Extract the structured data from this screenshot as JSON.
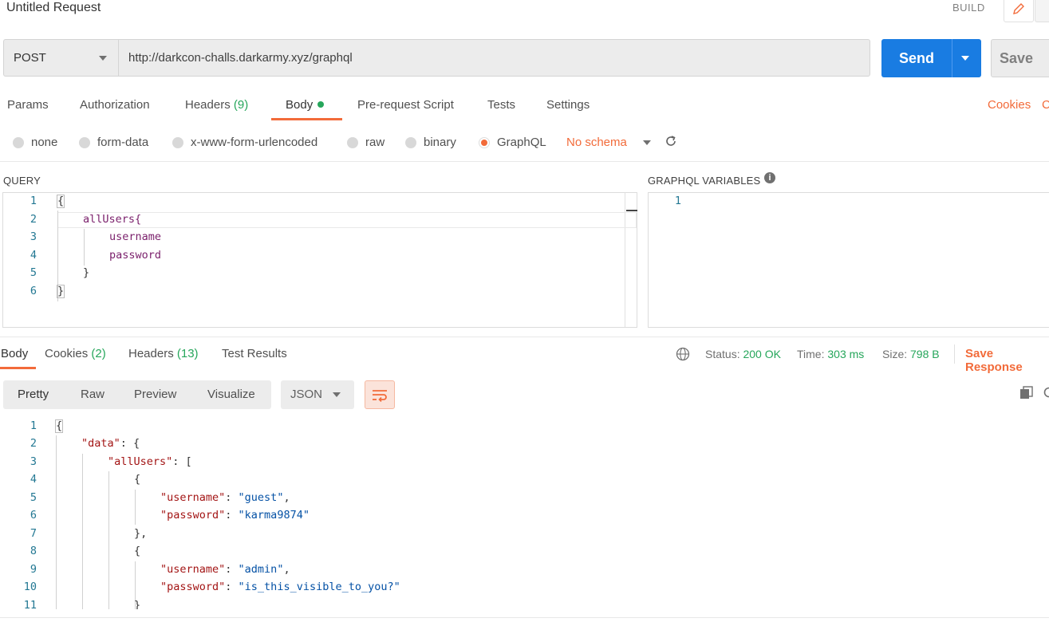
{
  "header": {
    "title": "Untitled Request",
    "build_label": "BUILD"
  },
  "request": {
    "method": "POST",
    "url": "http://darkcon-challs.darkarmy.xyz/graphql",
    "send_label": "Send",
    "save_label": "Save"
  },
  "tabs": {
    "params": "Params",
    "authorization": "Authorization",
    "headers": "Headers",
    "headers_count": "(9)",
    "body": "Body",
    "prerequest": "Pre-request Script",
    "tests": "Tests",
    "settings": "Settings",
    "cookies": "Cookies",
    "code": "C"
  },
  "body_types": {
    "none": "none",
    "form_data": "form-data",
    "urlencoded": "x-www-form-urlencoded",
    "raw": "raw",
    "binary": "binary",
    "graphql": "GraphQL",
    "schema": "No schema"
  },
  "query": {
    "label": "QUERY",
    "lines": [
      {
        "n": "1",
        "text": "{"
      },
      {
        "n": "2",
        "text": "allUsers{"
      },
      {
        "n": "3",
        "text": "username"
      },
      {
        "n": "4",
        "text": "password"
      },
      {
        "n": "5",
        "text": "}"
      },
      {
        "n": "6",
        "text": "}"
      }
    ]
  },
  "variables": {
    "label": "GRAPHQL VARIABLES",
    "line1": "1"
  },
  "response": {
    "tabs": {
      "body": "Body",
      "cookies": "Cookies",
      "cookies_count": "(2)",
      "headers": "Headers",
      "headers_count": "(13)",
      "tests": "Test Results"
    },
    "status_label": "Status:",
    "status_value": "200 OK",
    "time_label": "Time:",
    "time_value": "303 ms",
    "size_label": "Size:",
    "size_value": "798 B",
    "save_response": "Save Response",
    "views": {
      "pretty": "Pretty",
      "raw": "Raw",
      "preview": "Preview",
      "visualize": "Visualize"
    },
    "format": "JSON",
    "lines": [
      {
        "n": "1",
        "text": "{"
      },
      {
        "n": "2",
        "key": "\"data\"",
        "rest": ": {"
      },
      {
        "n": "3",
        "key": "\"allUsers\"",
        "rest": ": ["
      },
      {
        "n": "4",
        "text": "{"
      },
      {
        "n": "5",
        "key": "\"username\"",
        "sep": ": ",
        "val": "\"guest\"",
        "tail": ","
      },
      {
        "n": "6",
        "key": "\"password\"",
        "sep": ": ",
        "val": "\"karma9874\"",
        "tail": ""
      },
      {
        "n": "7",
        "text": "},"
      },
      {
        "n": "8",
        "text": "{"
      },
      {
        "n": "9",
        "key": "\"username\"",
        "sep": ": ",
        "val": "\"admin\"",
        "tail": ","
      },
      {
        "n": "10",
        "key": "\"password\"",
        "sep": ": ",
        "val": "\"is_this_visible_to_you?\"",
        "tail": ""
      },
      {
        "n": "11",
        "text": "}"
      }
    ]
  },
  "colors": {
    "accent": "#f26b3a",
    "send": "#197ce2",
    "success": "#26a65b"
  }
}
